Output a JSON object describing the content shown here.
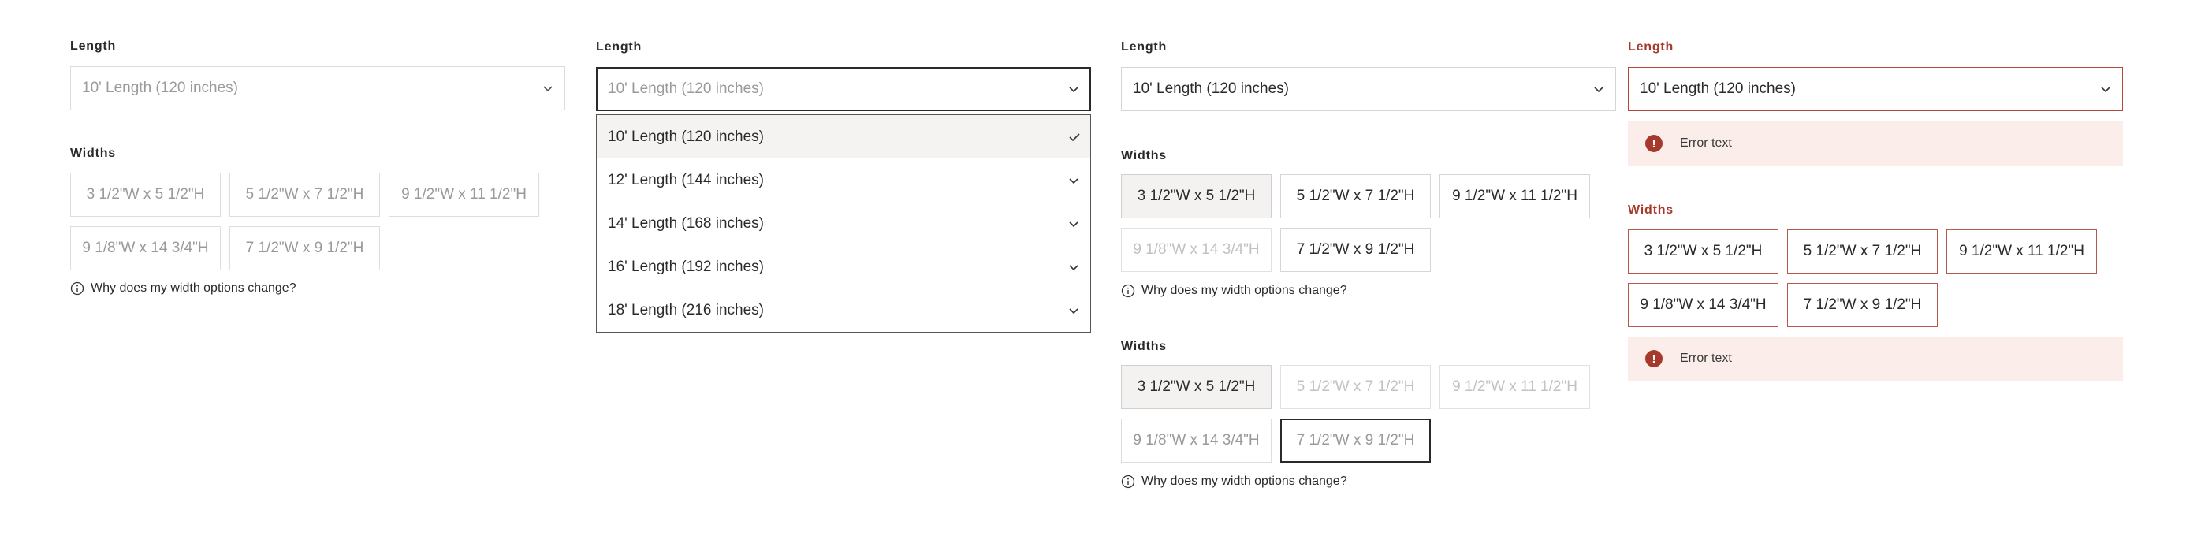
{
  "colors": {
    "error": "#a6392b",
    "error_bg": "#fbeeea",
    "selected_bg": "#f3f2f0",
    "text": "#2a2a2a",
    "muted": "#9a9a9a"
  },
  "icons": {
    "chevron": "chevron-down-icon",
    "check": "check-icon",
    "info": "info-icon",
    "error": "error-icon"
  },
  "panel1": {
    "length_label": "Length",
    "select_value": "10' Length (120 inches)",
    "widths_label": "Widths",
    "widths": [
      "3 1/2\"W x 5 1/2\"H",
      "5 1/2\"W x 7 1/2\"H",
      "9 1/2\"W x 11 1/2\"H",
      "9 1/8\"W x 14 3/4\"H",
      "7 1/2\"W x 9 1/2\"H"
    ],
    "help": "Why does my width options change?"
  },
  "panel2": {
    "length_label": "Length",
    "select_value": "10' Length (120 inches)",
    "options": [
      "10' Length (120 inches)",
      "12' Length (144 inches)",
      "14' Length (168 inches)",
      "16' Length (192 inches)",
      "18' Length (216 inches)"
    ],
    "selected_index": 0
  },
  "panel3": {
    "length_label": "Length",
    "select_value": "10' Length (120 inches)",
    "widths_label": "Widths",
    "widths": [
      "3 1/2\"W x 5 1/2\"H",
      "5 1/2\"W x 7 1/2\"H",
      "9 1/2\"W x 11 1/2\"H",
      "9 1/8\"W x 14 3/4\"H",
      "7 1/2\"W x 9 1/2\"H"
    ],
    "help": "Why does my width options change?",
    "widths_b_label": "Widths",
    "widths_b": [
      "3 1/2\"W x 5 1/2\"H",
      "5 1/2\"W x 7 1/2\"H",
      "9 1/2\"W x 11 1/2\"H",
      "9 1/8\"W x 14 3/4\"H",
      "7 1/2\"W x 9 1/2\"H"
    ],
    "help_b": "Why does my width options change?"
  },
  "panel4": {
    "length_label": "Length",
    "select_value": "10' Length (120 inches)",
    "error_text": "Error text",
    "widths_label": "Widths",
    "widths": [
      "3 1/2\"W x 5 1/2\"H",
      "5 1/2\"W x 7 1/2\"H",
      "9 1/2\"W x 11 1/2\"H",
      "9 1/8\"W x 14 3/4\"H",
      "7 1/2\"W x 9 1/2\"H"
    ],
    "error_text_2": "Error text",
    "error_glyph": "!"
  }
}
